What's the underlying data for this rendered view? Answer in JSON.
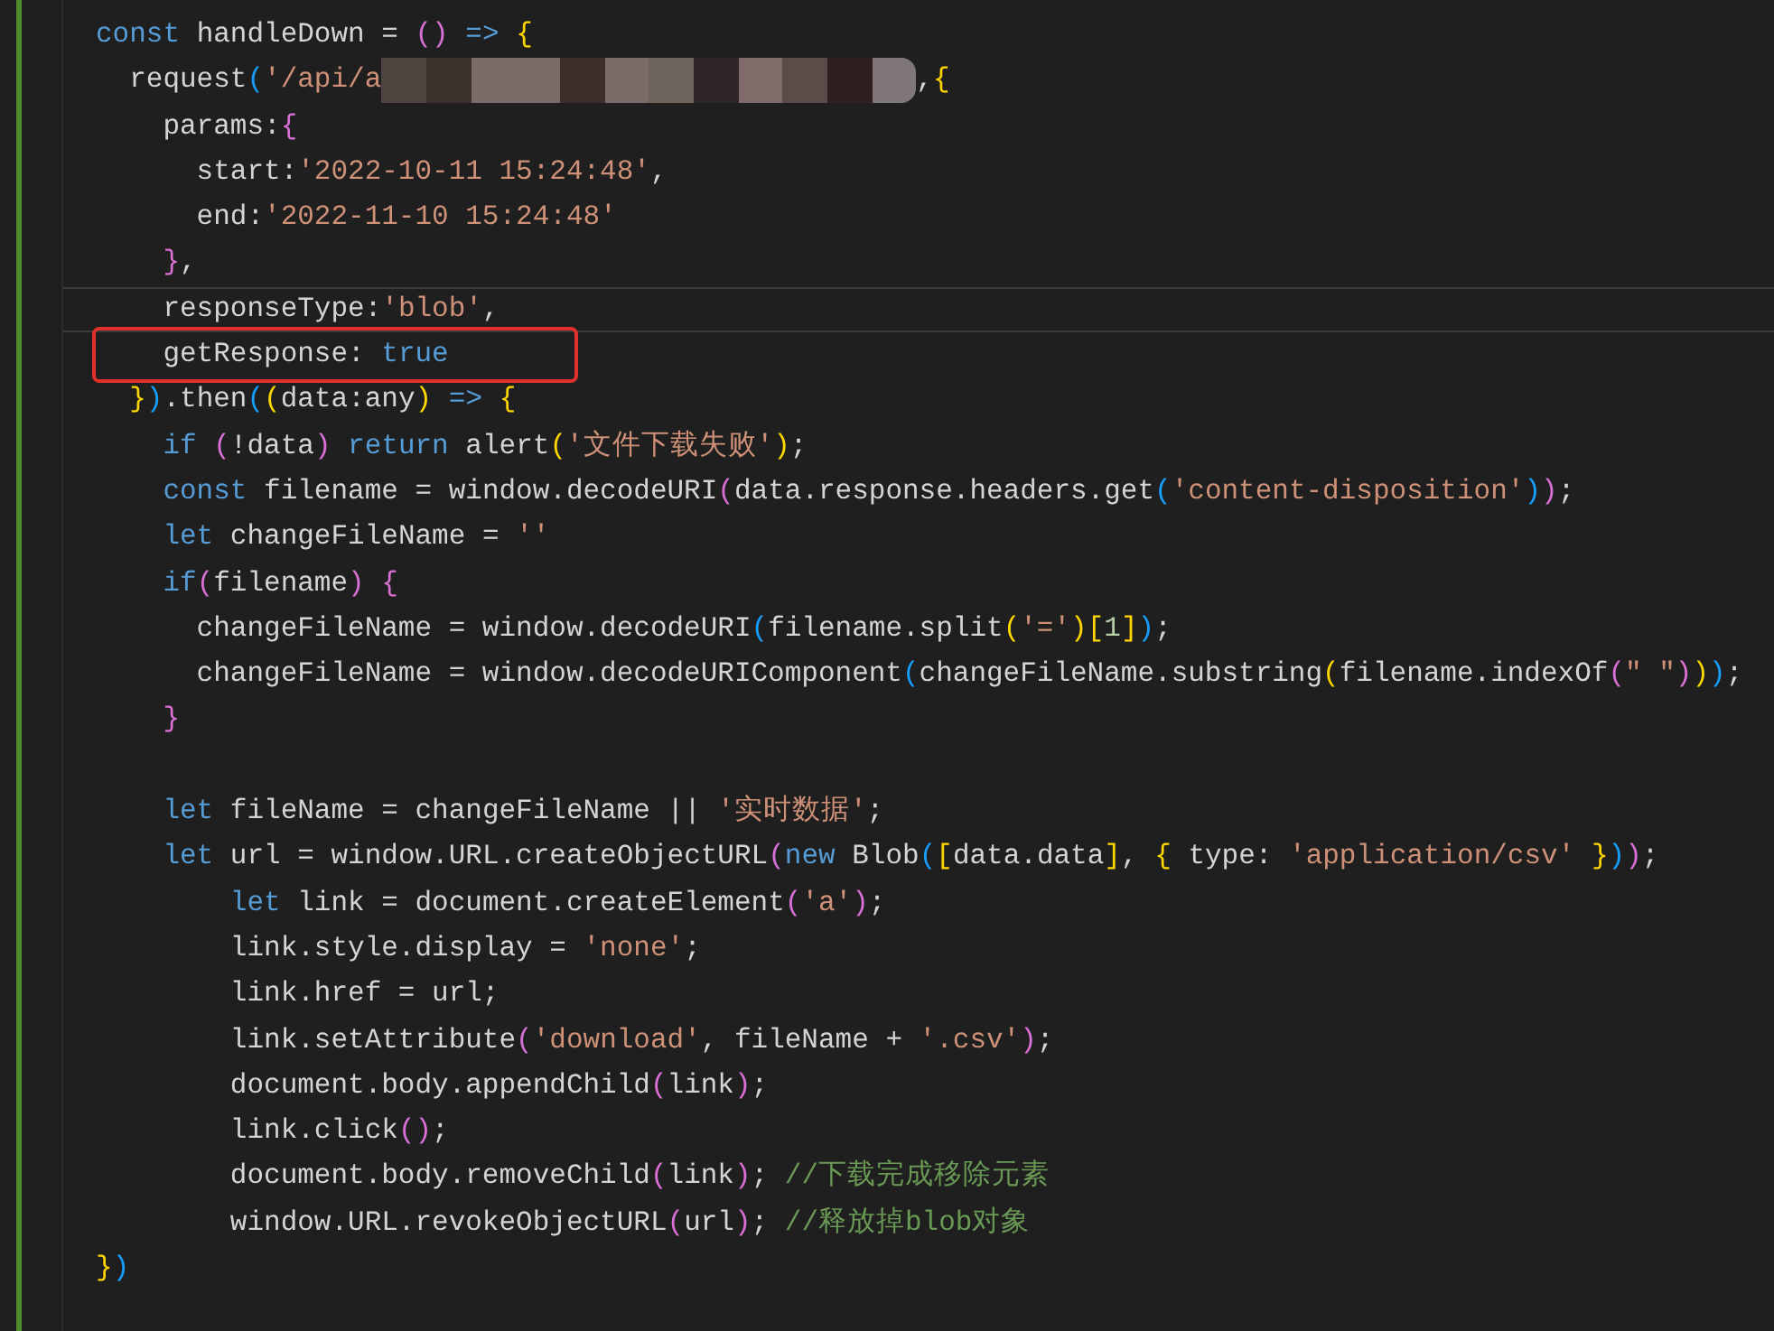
{
  "editor": {
    "lines": [
      {
        "kind": "code",
        "tokens": [
          {
            "kind": "keyword",
            "text": "const"
          },
          {
            "kind": "plain",
            "text": " handleDown = "
          },
          {
            "kind": "b2",
            "text": "()"
          },
          {
            "kind": "keyword",
            "text": " => "
          },
          {
            "kind": "b1",
            "text": "{"
          }
        ]
      },
      {
        "kind": "code",
        "tokens": [
          {
            "kind": "plain",
            "text": "  request"
          },
          {
            "kind": "b3",
            "text": "("
          },
          {
            "kind": "string",
            "text": "'/api/a"
          },
          {
            "kind": "redacted"
          },
          {
            "kind": "plain",
            "text": ","
          },
          {
            "kind": "b1",
            "text": "{"
          }
        ]
      },
      {
        "kind": "code",
        "tokens": [
          {
            "kind": "plain",
            "text": "    params:"
          },
          {
            "kind": "b2",
            "text": "{"
          }
        ]
      },
      {
        "kind": "code",
        "tokens": [
          {
            "kind": "plain",
            "text": "      start:"
          },
          {
            "kind": "string",
            "text": "'2022-10-11 15:24:48'"
          },
          {
            "kind": "plain",
            "text": ","
          }
        ]
      },
      {
        "kind": "code",
        "tokens": [
          {
            "kind": "plain",
            "text": "      end:"
          },
          {
            "kind": "string",
            "text": "'2022-11-10 15:24:48'"
          }
        ]
      },
      {
        "kind": "code",
        "tokens": [
          {
            "kind": "b2",
            "text": "    }"
          },
          {
            "kind": "plain",
            "text": ","
          }
        ]
      },
      {
        "kind": "code",
        "current": true,
        "tokens": [
          {
            "kind": "plain",
            "text": "    responseType:"
          },
          {
            "kind": "string",
            "text": "'blob'"
          },
          {
            "kind": "plain",
            "text": ","
          }
        ]
      },
      {
        "kind": "code",
        "highlighted": true,
        "tokens": [
          {
            "kind": "plain",
            "text": "    getResponse: "
          },
          {
            "kind": "keyword",
            "text": "true"
          }
        ]
      },
      {
        "kind": "code",
        "tokens": [
          {
            "kind": "b1",
            "text": "  }"
          },
          {
            "kind": "b3",
            "text": ")"
          },
          {
            "kind": "plain",
            "text": ".then"
          },
          {
            "kind": "b3",
            "text": "("
          },
          {
            "kind": "b1",
            "text": "("
          },
          {
            "kind": "plain",
            "text": "data:any"
          },
          {
            "kind": "b1",
            "text": ")"
          },
          {
            "kind": "keyword",
            "text": " => "
          },
          {
            "kind": "b1",
            "text": "{"
          }
        ]
      },
      {
        "kind": "code",
        "tokens": [
          {
            "kind": "keyword",
            "text": "    if"
          },
          {
            "kind": "b2",
            "text": " ("
          },
          {
            "kind": "plain",
            "text": "!data"
          },
          {
            "kind": "b2",
            "text": ")"
          },
          {
            "kind": "keyword",
            "text": " return"
          },
          {
            "kind": "plain",
            "text": " alert"
          },
          {
            "kind": "b1",
            "text": "("
          },
          {
            "kind": "string",
            "text": "'文件下载失败'"
          },
          {
            "kind": "b1",
            "text": ")"
          },
          {
            "kind": "plain",
            "text": ";"
          }
        ]
      },
      {
        "kind": "code",
        "tokens": [
          {
            "kind": "keyword",
            "text": "    const"
          },
          {
            "kind": "plain",
            "text": " filename = window.decodeURI"
          },
          {
            "kind": "b2",
            "text": "("
          },
          {
            "kind": "plain",
            "text": "data.response.headers.get"
          },
          {
            "kind": "b3",
            "text": "("
          },
          {
            "kind": "string",
            "text": "'content-disposition'"
          },
          {
            "kind": "b3",
            "text": ")"
          },
          {
            "kind": "b2",
            "text": ")"
          },
          {
            "kind": "plain",
            "text": ";"
          }
        ]
      },
      {
        "kind": "code",
        "tokens": [
          {
            "kind": "keyword",
            "text": "    let"
          },
          {
            "kind": "plain",
            "text": " changeFileName = "
          },
          {
            "kind": "string",
            "text": "''"
          }
        ]
      },
      {
        "kind": "code",
        "tokens": [
          {
            "kind": "keyword",
            "text": "    if"
          },
          {
            "kind": "b2",
            "text": "("
          },
          {
            "kind": "plain",
            "text": "filename"
          },
          {
            "kind": "b2",
            "text": ")"
          },
          {
            "kind": "b2",
            "text": " {"
          }
        ]
      },
      {
        "kind": "code",
        "tokens": [
          {
            "kind": "plain",
            "text": "      changeFileName = window.decodeURI"
          },
          {
            "kind": "b3",
            "text": "("
          },
          {
            "kind": "plain",
            "text": "filename.split"
          },
          {
            "kind": "b1",
            "text": "("
          },
          {
            "kind": "string",
            "text": "'='"
          },
          {
            "kind": "b1",
            "text": ")["
          },
          {
            "kind": "number",
            "text": "1"
          },
          {
            "kind": "b1",
            "text": "]"
          },
          {
            "kind": "b3",
            "text": ")"
          },
          {
            "kind": "plain",
            "text": ";"
          }
        ]
      },
      {
        "kind": "code",
        "tokens": [
          {
            "kind": "plain",
            "text": "      changeFileName = window.decodeURIComponent"
          },
          {
            "kind": "b3",
            "text": "("
          },
          {
            "kind": "plain",
            "text": "changeFileName.substring"
          },
          {
            "kind": "b1",
            "text": "("
          },
          {
            "kind": "plain",
            "text": "filename.indexOf"
          },
          {
            "kind": "b2",
            "text": "("
          },
          {
            "kind": "string",
            "text": "\" \""
          },
          {
            "kind": "b2",
            "text": ")"
          },
          {
            "kind": "b1",
            "text": ")"
          },
          {
            "kind": "b3",
            "text": ")"
          },
          {
            "kind": "plain",
            "text": ";"
          }
        ]
      },
      {
        "kind": "code",
        "tokens": [
          {
            "kind": "b2",
            "text": "    }"
          }
        ]
      },
      {
        "kind": "blank"
      },
      {
        "kind": "code",
        "tokens": [
          {
            "kind": "keyword",
            "text": "    let"
          },
          {
            "kind": "plain",
            "text": " fileName = changeFileName || "
          },
          {
            "kind": "string",
            "text": "'实时数据'"
          },
          {
            "kind": "plain",
            "text": ";"
          }
        ]
      },
      {
        "kind": "code",
        "tokens": [
          {
            "kind": "keyword",
            "text": "    let"
          },
          {
            "kind": "plain",
            "text": " url = window.URL.createObjectURL"
          },
          {
            "kind": "b2",
            "text": "("
          },
          {
            "kind": "keyword",
            "text": "new"
          },
          {
            "kind": "plain",
            "text": " Blob"
          },
          {
            "kind": "b3",
            "text": "("
          },
          {
            "kind": "b1",
            "text": "["
          },
          {
            "kind": "plain",
            "text": "data.data"
          },
          {
            "kind": "b1",
            "text": "]"
          },
          {
            "kind": "plain",
            "text": ", "
          },
          {
            "kind": "b1",
            "text": "{"
          },
          {
            "kind": "plain",
            "text": " type: "
          },
          {
            "kind": "string",
            "text": "'application/csv'"
          },
          {
            "kind": "b1",
            "text": " }"
          },
          {
            "kind": "b3",
            "text": ")"
          },
          {
            "kind": "b2",
            "text": ")"
          },
          {
            "kind": "plain",
            "text": ";"
          }
        ]
      },
      {
        "kind": "code",
        "tokens": [
          {
            "kind": "keyword",
            "text": "        let"
          },
          {
            "kind": "plain",
            "text": " link = document.createElement"
          },
          {
            "kind": "b2",
            "text": "("
          },
          {
            "kind": "string",
            "text": "'a'"
          },
          {
            "kind": "b2",
            "text": ")"
          },
          {
            "kind": "plain",
            "text": ";"
          }
        ]
      },
      {
        "kind": "code",
        "tokens": [
          {
            "kind": "plain",
            "text": "        link.style.display = "
          },
          {
            "kind": "string",
            "text": "'none'"
          },
          {
            "kind": "plain",
            "text": ";"
          }
        ]
      },
      {
        "kind": "code",
        "tokens": [
          {
            "kind": "plain",
            "text": "        link.href = url;"
          }
        ]
      },
      {
        "kind": "code",
        "tokens": [
          {
            "kind": "plain",
            "text": "        link.setAttribute"
          },
          {
            "kind": "b2",
            "text": "("
          },
          {
            "kind": "string",
            "text": "'download'"
          },
          {
            "kind": "plain",
            "text": ", fileName + "
          },
          {
            "kind": "string",
            "text": "'.csv'"
          },
          {
            "kind": "b2",
            "text": ")"
          },
          {
            "kind": "plain",
            "text": ";"
          }
        ]
      },
      {
        "kind": "code",
        "tokens": [
          {
            "kind": "plain",
            "text": "        document.body.appendChild"
          },
          {
            "kind": "b2",
            "text": "("
          },
          {
            "kind": "plain",
            "text": "link"
          },
          {
            "kind": "b2",
            "text": ")"
          },
          {
            "kind": "plain",
            "text": ";"
          }
        ]
      },
      {
        "kind": "code",
        "tokens": [
          {
            "kind": "plain",
            "text": "        link.click"
          },
          {
            "kind": "b2",
            "text": "()"
          },
          {
            "kind": "plain",
            "text": ";"
          }
        ]
      },
      {
        "kind": "code",
        "tokens": [
          {
            "kind": "plain",
            "text": "        document.body.removeChild"
          },
          {
            "kind": "b2",
            "text": "("
          },
          {
            "kind": "plain",
            "text": "link"
          },
          {
            "kind": "b2",
            "text": ")"
          },
          {
            "kind": "plain",
            "text": "; "
          },
          {
            "kind": "comment",
            "text": "//下载完成移除元素"
          }
        ]
      },
      {
        "kind": "code",
        "tokens": [
          {
            "kind": "plain",
            "text": "        window.URL.revokeObjectURL"
          },
          {
            "kind": "b2",
            "text": "("
          },
          {
            "kind": "plain",
            "text": "url"
          },
          {
            "kind": "b2",
            "text": ")"
          },
          {
            "kind": "plain",
            "text": "; "
          },
          {
            "kind": "comment",
            "text": "//释放掉blob对象"
          }
        ]
      },
      {
        "kind": "code",
        "tokens": [
          {
            "kind": "b1",
            "text": "}"
          },
          {
            "kind": "b3",
            "text": ")"
          }
        ]
      }
    ]
  }
}
